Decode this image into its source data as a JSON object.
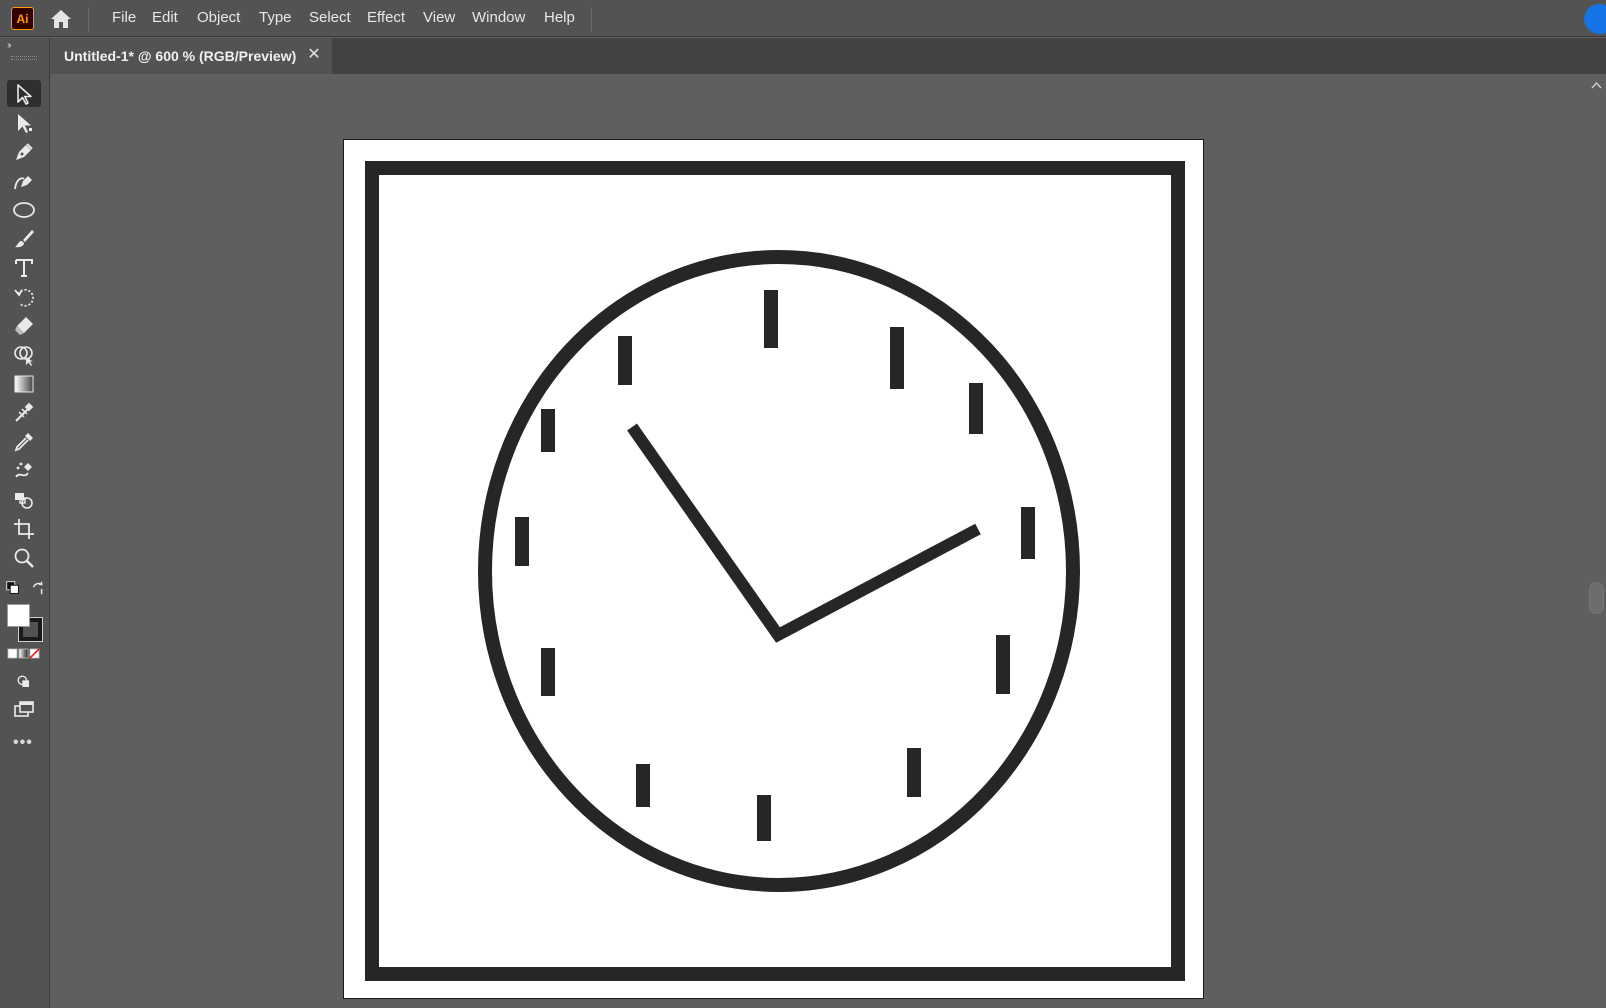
{
  "app": {
    "logo_text": "Ai",
    "home_icon": "home-icon"
  },
  "menu": {
    "items": [
      "File",
      "Edit",
      "Object",
      "Type",
      "Select",
      "Effect",
      "View",
      "Window",
      "Help"
    ]
  },
  "document_tab": {
    "title": "Untitled-1* @ 600 % (RGB/Preview)",
    "close_glyph": "✕"
  },
  "toolbar": {
    "collapse_glyph": "››",
    "tools": [
      {
        "name": "selection-tool",
        "icon": "selection-arrow-icon",
        "active": true
      },
      {
        "name": "direct-selection-tool",
        "icon": "direct-selection-arrow-icon"
      },
      {
        "name": "pen-tool",
        "icon": "pen-icon"
      },
      {
        "name": "curvature-tool",
        "icon": "curvature-pen-icon"
      },
      {
        "name": "ellipse-tool",
        "icon": "ellipse-icon"
      },
      {
        "name": "paintbrush-tool",
        "icon": "paintbrush-icon"
      },
      {
        "name": "type-tool",
        "icon": "type-icon"
      },
      {
        "name": "rotate-tool",
        "icon": "rotate-icon"
      },
      {
        "name": "eraser-tool",
        "icon": "eraser-icon"
      },
      {
        "name": "shape-builder-tool",
        "icon": "shape-builder-icon"
      },
      {
        "name": "gradient-tool",
        "icon": "gradient-icon"
      },
      {
        "name": "blend-tool",
        "icon": "blend-icon"
      },
      {
        "name": "eyedropper-tool",
        "icon": "eyedropper-icon"
      },
      {
        "name": "symbol-sprayer-tool",
        "icon": "symbol-sprayer-icon"
      },
      {
        "name": "live-paint-tool",
        "icon": "live-paint-icon"
      },
      {
        "name": "artboard-tool",
        "icon": "artboard-icon"
      },
      {
        "name": "zoom-tool",
        "icon": "zoom-icon"
      }
    ],
    "more_glyph": "•••"
  },
  "colors": {
    "accent": "#ff9a00",
    "menubar_bg": "#535353",
    "canvas_bg": "#5f5f5f",
    "artwork_stroke": "#262626",
    "account_blue": "#1473e6"
  },
  "artwork": {
    "description_icon": "clock-icon"
  }
}
